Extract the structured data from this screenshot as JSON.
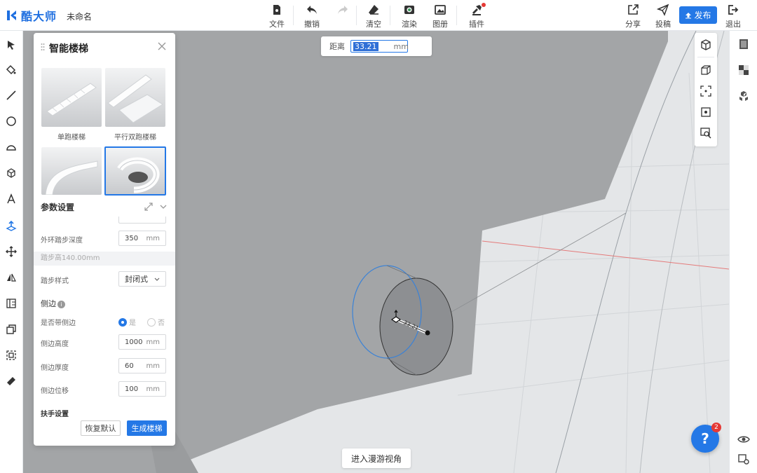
{
  "app": {
    "brand": "酷大师",
    "doc_name": "未命名"
  },
  "toolbar": {
    "file": "文件",
    "undo": "撤销",
    "clear": "清空",
    "render": "渲染",
    "album": "图册",
    "plugin": "插件",
    "share": "分享",
    "submit": "投稿",
    "publish": "发布",
    "exit": "退出"
  },
  "distance": {
    "label": "距离",
    "value": "33.21",
    "unit": "mm"
  },
  "panel": {
    "title": "智能楼梯",
    "templates": [
      {
        "label": "单跑楼梯",
        "selected": false
      },
      {
        "label": "平行双跑楼梯",
        "selected": false
      },
      {
        "label": "",
        "selected": false
      },
      {
        "label": "",
        "selected": true
      }
    ],
    "params_title": "参数设置",
    "outer_step_depth": {
      "label": "外环踏步深度",
      "value": "350",
      "unit": "mm"
    },
    "step_height_hint": "踏步高140.00mm",
    "step_style": {
      "label": "踏步样式",
      "value": "封闭式"
    },
    "side_title": "侧边",
    "has_side": {
      "label": "是否带侧边",
      "yes": "是",
      "no": "否",
      "selected": "yes"
    },
    "side_height": {
      "label": "侧边高度",
      "value": "1000",
      "unit": "mm"
    },
    "side_thickness": {
      "label": "侧边厚度",
      "value": "60",
      "unit": "mm"
    },
    "side_offset": {
      "label": "侧边位移",
      "value": "100",
      "unit": "mm"
    },
    "handrail_title": "扶手设置",
    "reset_button": "恢复默认",
    "generate_button": "生成楼梯"
  },
  "roam_button": "进入漫游视角",
  "help": {
    "label": "?",
    "badge": "2"
  },
  "measure_label": "33.21",
  "colors": {
    "accent": "#2478e6",
    "badge": "#e53935"
  }
}
